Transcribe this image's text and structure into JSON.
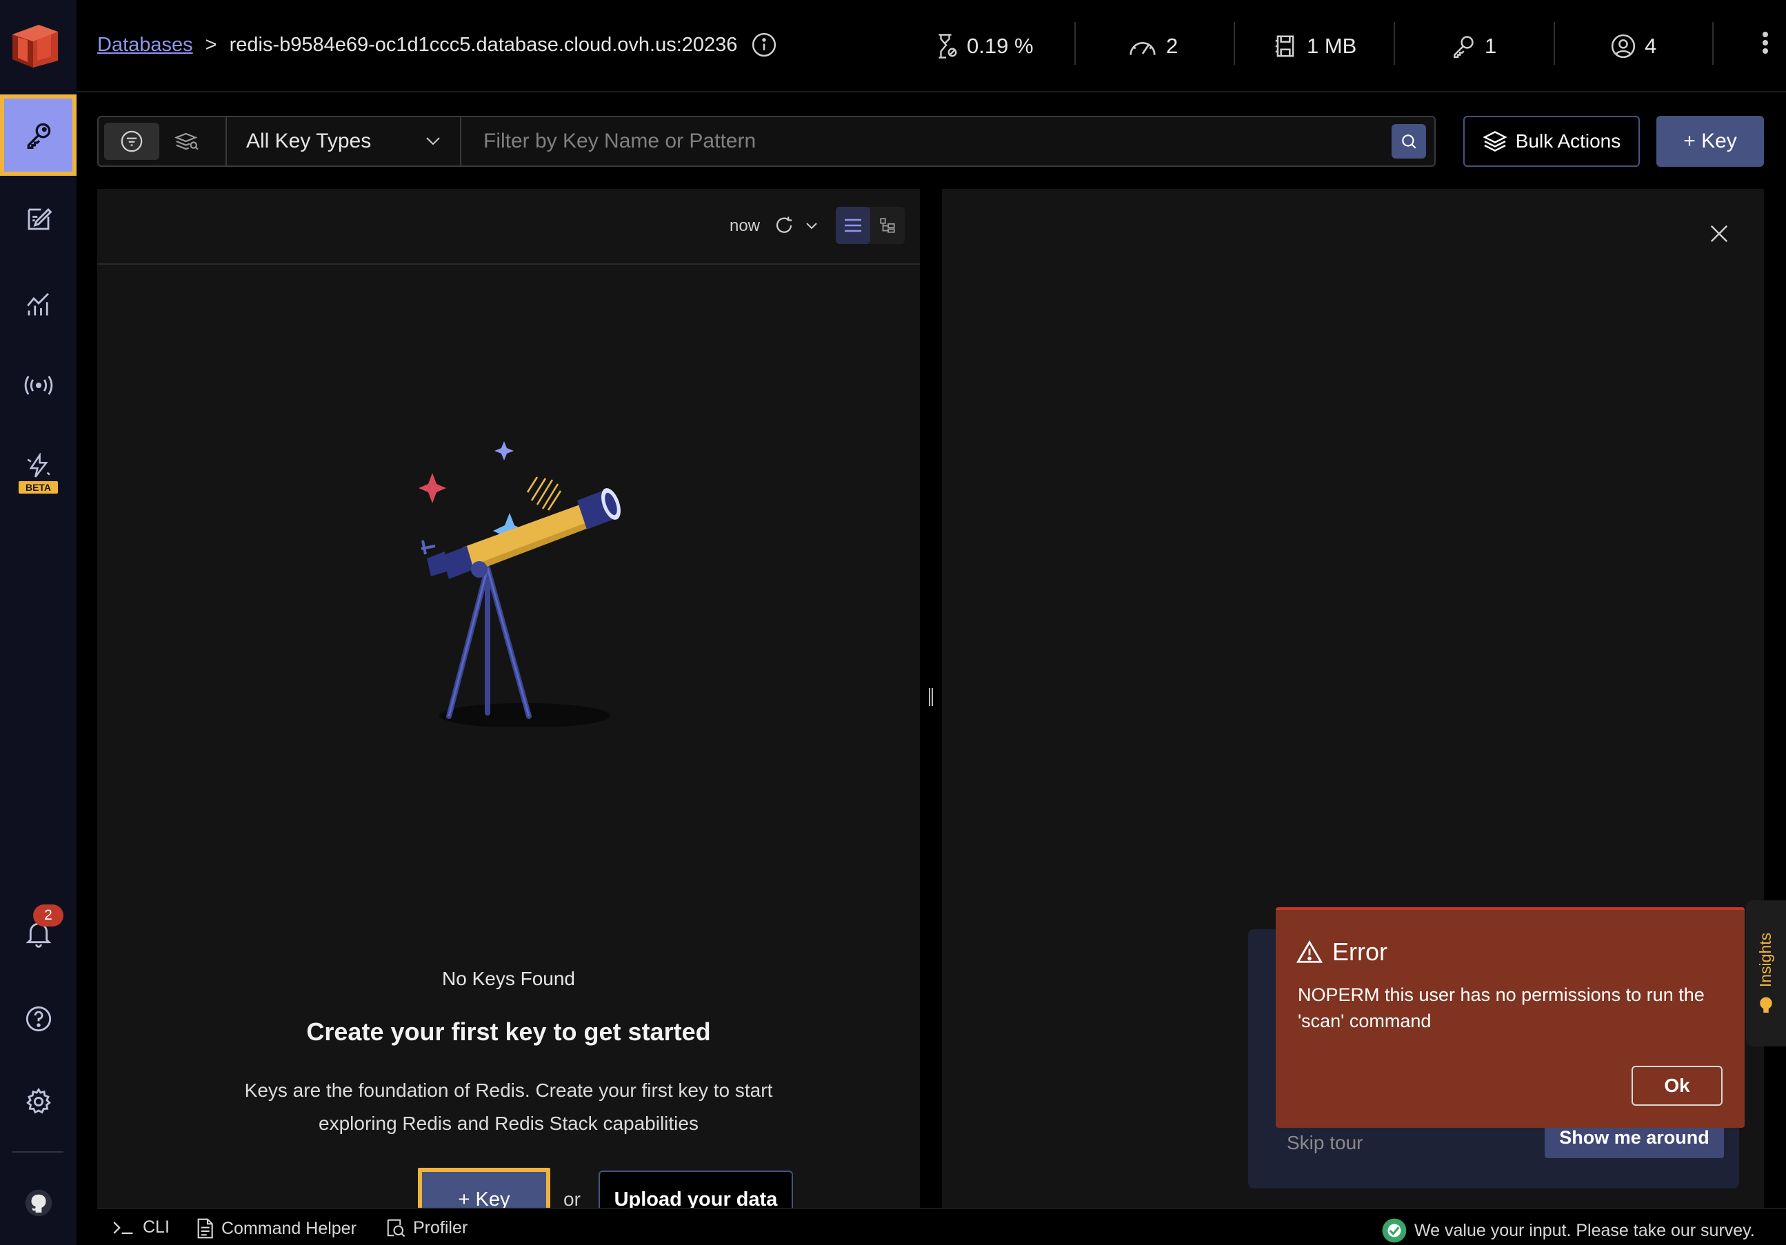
{
  "header": {
    "breadcrumb_root": "Databases",
    "breadcrumb_sep": ">",
    "db_host": "redis-b9584e69-oc1d1ccc5.database.cloud.ovh.us:20236",
    "stats": {
      "cpu": "0.19 %",
      "ops": "2",
      "memory": "1 MB",
      "keys": "1",
      "clients": "4"
    }
  },
  "sidebar": {
    "beta_label": "BETA",
    "notification_count": "2"
  },
  "filter": {
    "key_type": "All Key Types",
    "search_placeholder": "Filter by Key Name or Pattern",
    "bulk_actions_label": "Bulk Actions",
    "add_key_label": "+ Key"
  },
  "key_list": {
    "refresh_label": "now",
    "empty_title": "No Keys Found",
    "empty_heading": "Create your first key to get started",
    "empty_desc": "Keys are the foundation of Redis. Create your first key to start exploring Redis and Redis Stack capabilities",
    "cta_key_label": "+ Key",
    "cta_or": "or",
    "cta_upload_label": "Upload your data"
  },
  "tour": {
    "skip_label": "Skip tour",
    "show_label": "Show me around"
  },
  "error": {
    "title": "Error",
    "message": "NOPERM this user has no permissions to run the 'scan' command",
    "ok_label": "Ok"
  },
  "insights": {
    "label": "Insights"
  },
  "bottom_bar": {
    "cli_label": "CLI",
    "helper_label": "Command Helper",
    "profiler_label": "Profiler",
    "survey_label": "We value your input. Please take our survey."
  },
  "colors": {
    "accent": "#465282",
    "highlight": "#f0b43c",
    "error_bg": "#7f3320",
    "sidebar_bg": "#0e1020"
  }
}
